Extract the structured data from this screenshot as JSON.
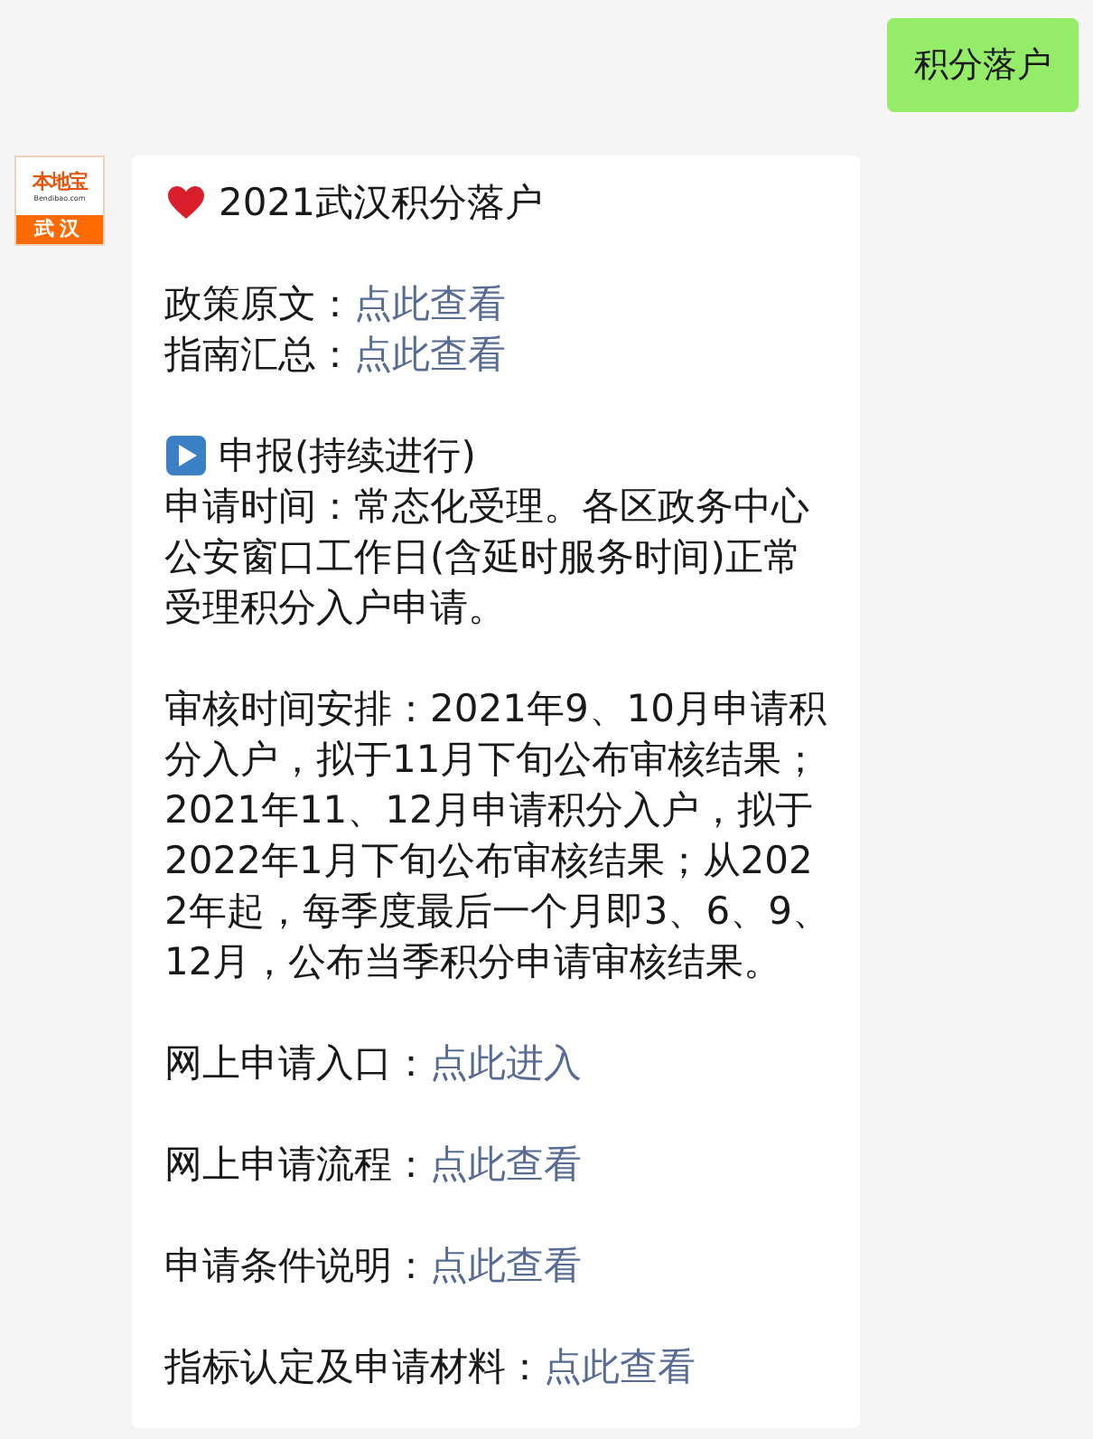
{
  "outgoing_message": {
    "text": "积分落户"
  },
  "sender_avatar": {
    "brand": "本地宝",
    "site": "Bendibao.com",
    "city": "武汉"
  },
  "incoming_message": {
    "sections": [
      [
        {
          "kind": "heart_heading",
          "text": "2021武汉积分落户"
        }
      ],
      [
        {
          "kind": "link_line",
          "label": "政策原文：",
          "link": "点此查看"
        },
        {
          "kind": "link_line",
          "label": "指南汇总：",
          "link": "点此查看"
        }
      ],
      [
        {
          "kind": "play_heading",
          "text": "申报(持续进行)"
        },
        {
          "kind": "text",
          "text": "申请时间：常态化受理。各区政务中心公安窗口工作日(含延时服务时间)正常受理积分入户申请。"
        }
      ],
      [
        {
          "kind": "text",
          "text": "审核时间安排：2021年9、10月申请积分入户，拟于11月下旬公布审核结果；2021年11、12月申请积分入户，拟于2022年1月下旬公布审核结果；从2022年起，每季度最后一个月即3、6、9、12月，公布当季积分申请审核结果。"
        }
      ],
      [
        {
          "kind": "link_line",
          "label": "网上申请入口：",
          "link": "点此进入"
        }
      ],
      [
        {
          "kind": "link_line",
          "label": "网上申请流程：",
          "link": "点此查看"
        }
      ],
      [
        {
          "kind": "link_line",
          "label": "申请条件说明：",
          "link": "点此查看"
        }
      ],
      [
        {
          "kind": "link_line",
          "label": "指标认定及申请材料：",
          "link": "点此查看"
        }
      ]
    ]
  }
}
